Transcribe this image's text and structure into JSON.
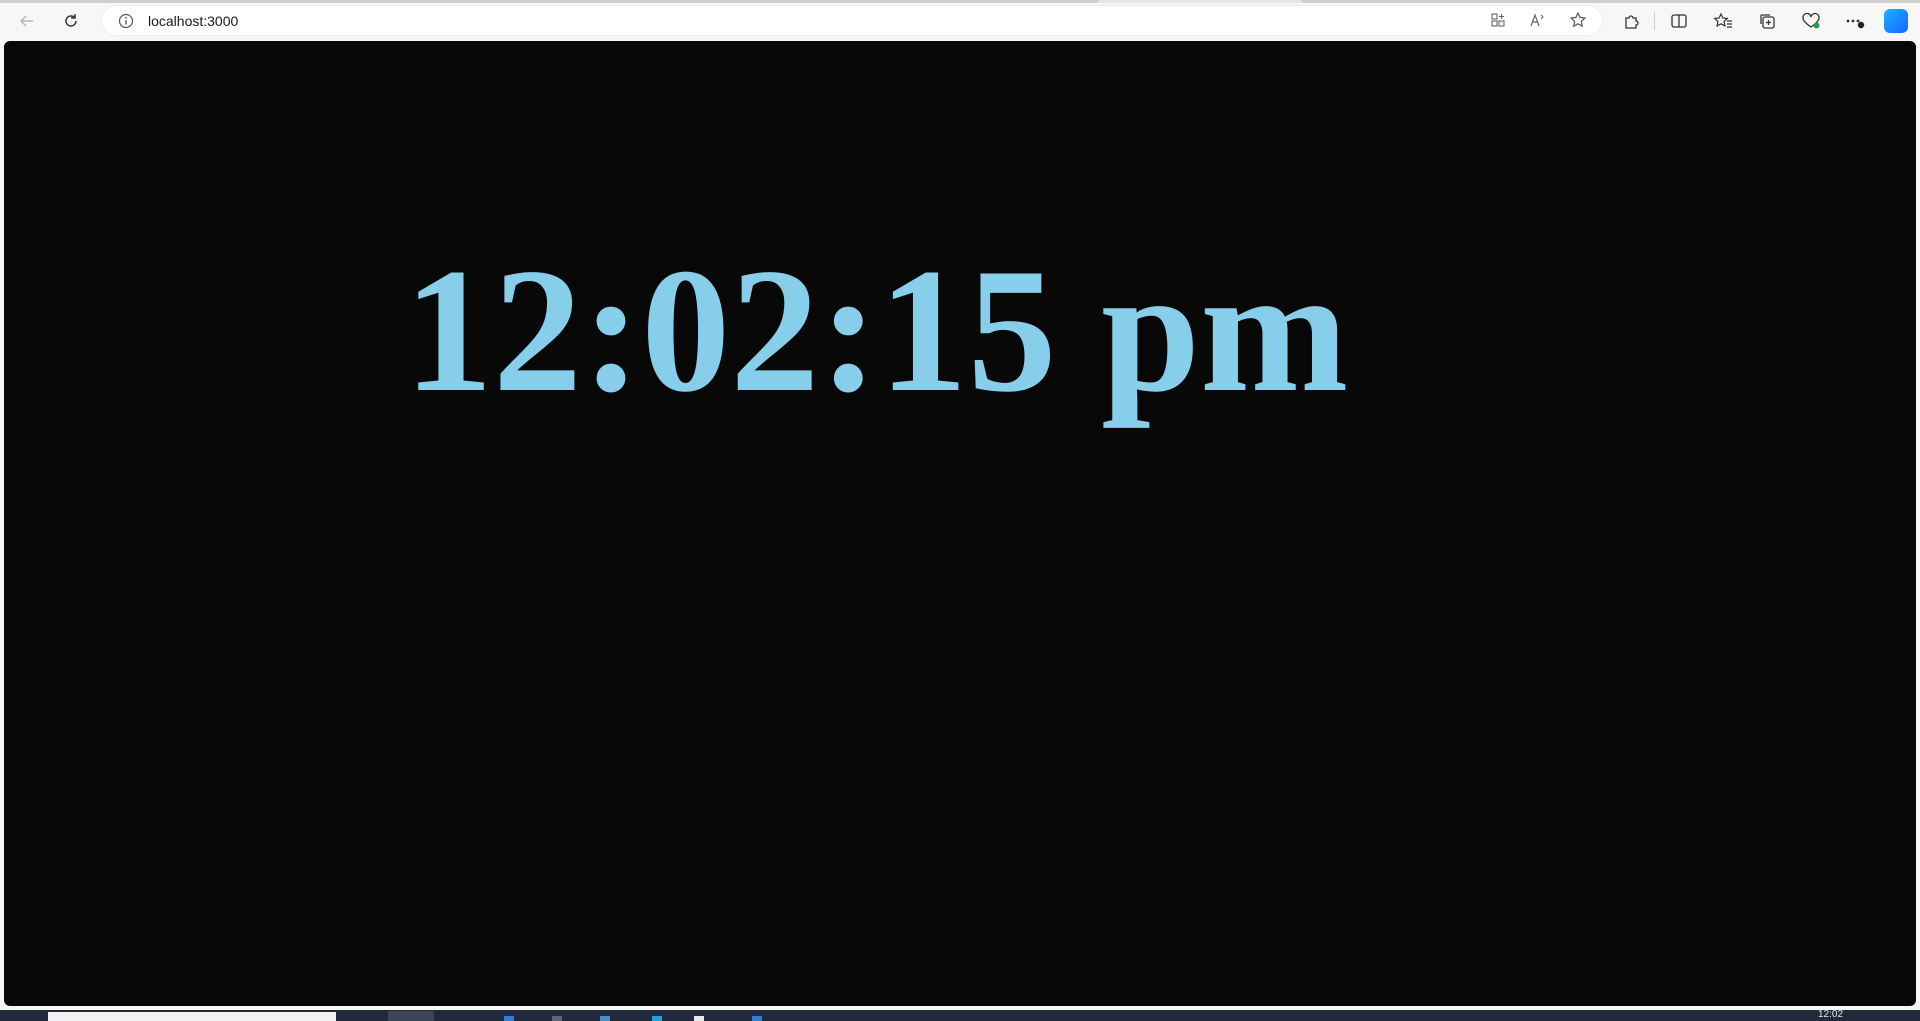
{
  "browser": {
    "url": "localhost:3000",
    "icons": {
      "back": "back-arrow-icon",
      "refresh": "refresh-icon",
      "site_info": "info-icon",
      "app_available": "apps-icon",
      "read_aloud": "read-aloud-icon",
      "favorite": "star-icon",
      "extensions": "puzzle-icon",
      "split_screen": "split-screen-icon",
      "favorites": "favorites-icon",
      "collections": "collections-icon",
      "browser_essentials": "heart-pulse-icon",
      "more": "more-dots-icon",
      "copilot": "copilot-icon"
    }
  },
  "page": {
    "clock_text": "12:02:15 pm",
    "clock_color": "#87ceeb",
    "background_color": "#080809"
  },
  "taskbar": {
    "time": "12:02"
  }
}
